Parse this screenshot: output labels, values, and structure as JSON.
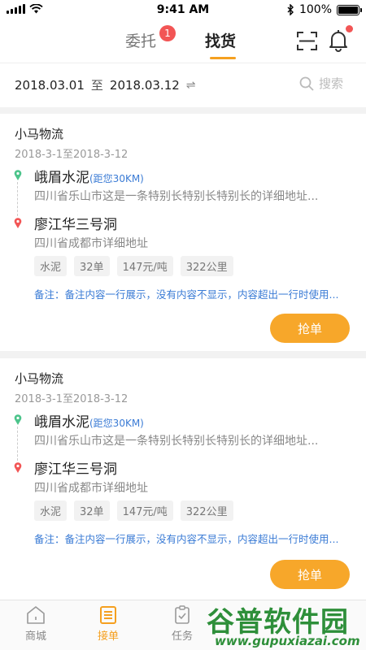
{
  "status_bar": {
    "time": "9:41 AM",
    "battery": "100%"
  },
  "header": {
    "tabs": [
      {
        "label": "委托",
        "badge": "1"
      },
      {
        "label": "找货"
      }
    ],
    "active_tab": "找货"
  },
  "filter": {
    "start_date": "2018.03.01",
    "separator": "至",
    "end_date": "2018.03.12",
    "search_label": "搜索"
  },
  "orders": [
    {
      "company": "小马物流",
      "period": "2018-3-1至2018-3-12",
      "origin_name": "峨眉水泥",
      "origin_distance": "(距您30KM)",
      "origin_address": "四川省乐山市这是一条特别长特别长特别长的详细地址...",
      "dest_name": "廖江华三号洞",
      "dest_address": "四川省成都市详细地址",
      "tags": [
        "水泥",
        "32单",
        "147元/吨",
        "322公里"
      ],
      "remark": "备注：备注内容一行展示，没有内容不显示，内容超出一行时使用...",
      "action": "抢单"
    },
    {
      "company": "小马物流",
      "period": "2018-3-1至2018-3-12",
      "origin_name": "峨眉水泥",
      "origin_distance": "(距您30KM)",
      "origin_address": "四川省乐山市这是一条特别长特别长特别长的详细地址...",
      "dest_name": "廖江华三号洞",
      "dest_address": "四川省成都市详细地址",
      "tags": [
        "水泥",
        "32单",
        "147元/吨",
        "322公里"
      ],
      "remark": "备注：备注内容一行展示，没有内容不显示，内容超出一行时使用...",
      "action": "抢单"
    }
  ],
  "tabbar": {
    "items": [
      {
        "label": "商城",
        "icon": "home-icon"
      },
      {
        "label": "接单",
        "icon": "orders-icon",
        "active": true
      },
      {
        "label": "任务",
        "icon": "clipboard-icon"
      }
    ]
  },
  "watermark": {
    "title": "谷普软件园",
    "url": "www.gupuxiazai.com"
  },
  "colors": {
    "accent": "#f5a020",
    "link": "#3a7bd5",
    "badge": "#f25555"
  }
}
